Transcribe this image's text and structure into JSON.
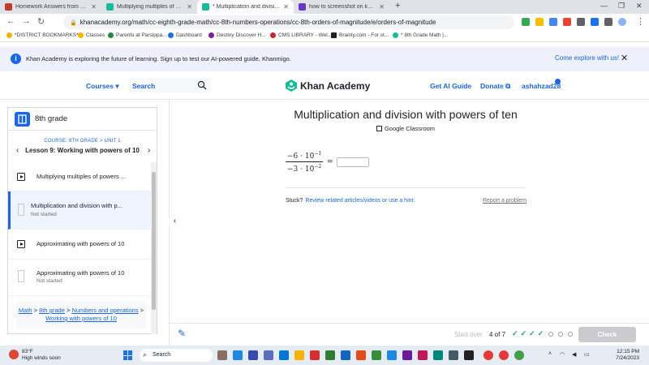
{
  "browser": {
    "tabs": [
      {
        "title": "Homework Answers from Subje...",
        "active": false,
        "color": "#c53929"
      },
      {
        "title": "Multiplying multiples of pow...",
        "active": false,
        "color": "#14bf96"
      },
      {
        "title": "* Multiplication and division with...",
        "active": true,
        "color": "#14bf96"
      },
      {
        "title": "how to screenshot on keyboard...",
        "active": false,
        "color": "#6b36c8"
      }
    ],
    "new_tab": "+",
    "url": "khanacademy.org/math/cc-eighth-grade-math/cc-8th-numbers-operations/cc-8th-orders-of-magnitude/e/orders-of-magnitude",
    "bookmarks": [
      "*DISTRICT BOOKMARKS*",
      "Classes",
      "Parents at Parsippa...",
      "Dashboard",
      "Destiny Discover H...",
      "CMS LIBRARY - Wel...",
      "Brainly.com - For st...",
      "* 8th Grade Math |..."
    ]
  },
  "banner": {
    "message": "Khan Academy is exploring the future of learning. Sign up to test our AI-powered guide, Khanmigo.",
    "cta": "Come explore with us!",
    "close": "✕"
  },
  "header": {
    "courses": "Courses ▾",
    "search_placeholder": "Search",
    "logo_text": "Khan Academy",
    "ai_guide": "Get AI Guide",
    "donate": "Donate ⧉",
    "username": "ashahzad28"
  },
  "sidebar": {
    "grade": "8th grade",
    "course_unit": "COURSE: 8TH GRADE > UNIT 1",
    "lesson": "Lesson 9: Working with powers of 10",
    "prev": "‹",
    "next": "›",
    "items": [
      {
        "title": "Multiplying multiples of powers ...",
        "subtitle": "",
        "type": "video",
        "selected": false
      },
      {
        "title": "Multiplication and division with p...",
        "subtitle": "Not started",
        "type": "exercise",
        "selected": true
      },
      {
        "title": "Approximating with powers of 10",
        "subtitle": "",
        "type": "video",
        "selected": false
      },
      {
        "title": "Approximating with powers of 10",
        "subtitle": "Not started",
        "type": "exercise",
        "selected": false
      }
    ],
    "breadcrumb": {
      "math": "Math",
      "grade": "8th grade",
      "unit": "Numbers and operations",
      "lesson": "Working with powers of 10",
      "sep": ">"
    }
  },
  "exercise": {
    "title": "Multiplication and division with powers of ten",
    "google_classroom": "Google Classroom",
    "numerator_coef": "−6 · 10",
    "numerator_exp": "−1",
    "denominator_coef": "−3 · 10",
    "denominator_exp": "−2",
    "equals": "=",
    "answer_value": "",
    "stuck": "Stuck?",
    "hint_link": "Review related articles/videos or use a hint.",
    "report": "Report a problem"
  },
  "footer": {
    "start_over": "Start over",
    "progress": "4 of 7",
    "completed_marks": 4,
    "remaining_marks": 3,
    "check": "Check"
  },
  "taskbar": {
    "temperature": "83°F",
    "weather": "High winds soon",
    "search": "Search",
    "time": "12:15 PM",
    "date": "7/24/2023"
  },
  "colors": {
    "ka_blue": "#1865f2",
    "ka_green": "#1fab54",
    "disabled_gray": "#c9cbcf"
  }
}
